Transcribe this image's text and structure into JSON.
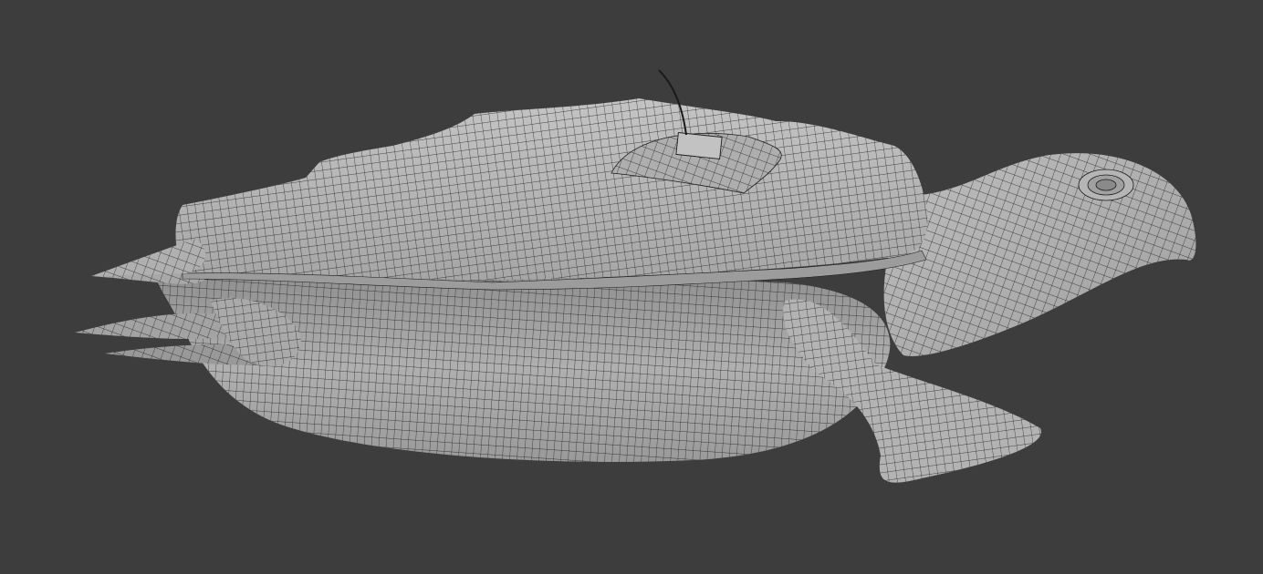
{
  "scene": {
    "subject": "turtle-wireframe-mesh",
    "colors": {
      "background": "#3d3d3d",
      "mesh_light": "#b9b9b9",
      "mesh_mid": "#9a9a9a",
      "mesh_dark": "#6e6e6e",
      "wire": "#1c1c1c"
    }
  }
}
